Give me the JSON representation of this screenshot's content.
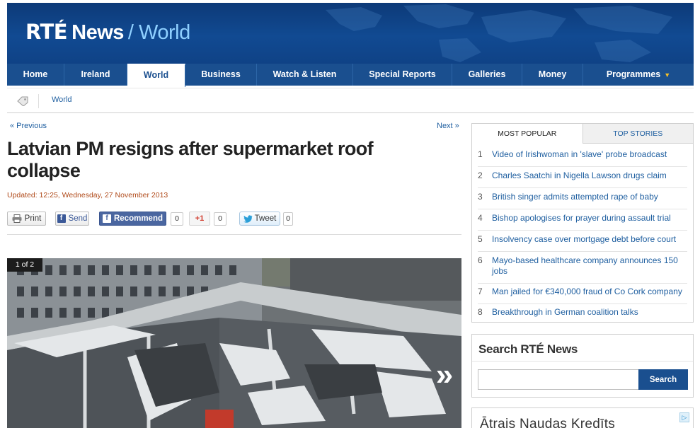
{
  "masthead": {
    "brand": "RTÉ",
    "product": "News",
    "section": "/ World"
  },
  "nav": [
    {
      "label": "Home",
      "active": false
    },
    {
      "label": "Ireland",
      "active": false
    },
    {
      "label": "World",
      "active": true
    },
    {
      "label": "Business",
      "active": false
    },
    {
      "label": "Watch & Listen",
      "active": false
    },
    {
      "label": "Special Reports",
      "active": false
    },
    {
      "label": "Galleries",
      "active": false
    },
    {
      "label": "Money",
      "active": false
    },
    {
      "label": "Programmes",
      "active": false
    }
  ],
  "breadcrumb": {
    "icon": "tag-icon",
    "current": "World"
  },
  "article": {
    "prev_label": "« Previous",
    "next_label": "Next »",
    "headline": "Latvian PM resigns after supermarket roof collapse",
    "updated": "Updated: 12:25, Wednesday, 27 November 2013",
    "share": {
      "print": "Print",
      "send": "Send",
      "recommend": "Recommend",
      "recommend_count": "0",
      "gplus": "+1",
      "gplus_count": "0",
      "tweet": "Tweet",
      "tweet_count": "0"
    },
    "gallery": {
      "counter": "1 of 2",
      "next_icon": "chevron-right-icon"
    }
  },
  "popular": {
    "tabs": [
      {
        "label": "MOST POPULAR",
        "active": true
      },
      {
        "label": "TOP STORIES",
        "active": false
      }
    ],
    "items": [
      {
        "num": "1",
        "text": "Video of Irishwoman in 'slave' probe broadcast"
      },
      {
        "num": "2",
        "text": "Charles Saatchi in Nigella Lawson drugs claim"
      },
      {
        "num": "3",
        "text": "British singer admits attempted rape of baby"
      },
      {
        "num": "4",
        "text": "Bishop apologises for prayer during assault trial"
      },
      {
        "num": "5",
        "text": "Insolvency case over mortgage debt before court"
      },
      {
        "num": "6",
        "text": "Mayo-based healthcare company announces 150 jobs"
      },
      {
        "num": "7",
        "text": "Man jailed for €340,000 fraud of Co Cork company"
      },
      {
        "num": "8",
        "text": "Breakthrough in German coalition talks"
      }
    ]
  },
  "search": {
    "title": "Search RTÉ News",
    "value": "",
    "button": "Search"
  },
  "ad": {
    "text": "Ātrais Naudas Kredīts",
    "choice_icon": "ad-choices-icon"
  },
  "colors": {
    "brand_blue": "#1a4f8f",
    "link": "#1f5fa0",
    "updated": "#b04a1a"
  }
}
